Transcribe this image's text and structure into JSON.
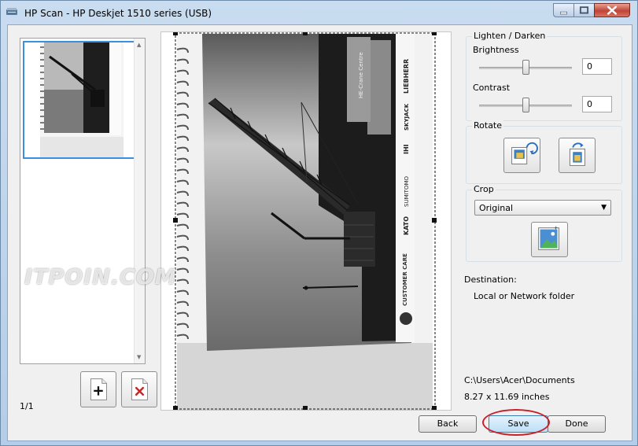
{
  "window": {
    "title": "HP Scan - HP Deskjet 1510 series (USB)"
  },
  "thumbnails": {
    "page_count": "1/1"
  },
  "adjust": {
    "heading": "Lighten / Darken",
    "brightness_label": "Brightness",
    "brightness_value": "0",
    "contrast_label": "Contrast",
    "contrast_value": "0"
  },
  "rotate": {
    "heading": "Rotate"
  },
  "crop": {
    "heading": "Crop",
    "selected": "Original"
  },
  "destination": {
    "label": "Destination:",
    "value": "Local or Network folder",
    "path": "C:\\Users\\Acer\\Documents",
    "size": "8.27 x 11.69 inches"
  },
  "buttons": {
    "back": "Back",
    "save": "Save",
    "done": "Done"
  },
  "scan_text": {
    "brand1": "LIEBHERR",
    "brand2": "SKYJACK",
    "brand3": "IHI",
    "brand4": "SUMITOMO",
    "brand5": "KATO",
    "care": "CUSTOMER CARE",
    "panel": "HE-Crane Centre"
  },
  "watermark": "ITPOIN.COM",
  "colors": {
    "accent": "#3c8fe0",
    "annotation": "#c8202a",
    "close": "#c0433a"
  }
}
